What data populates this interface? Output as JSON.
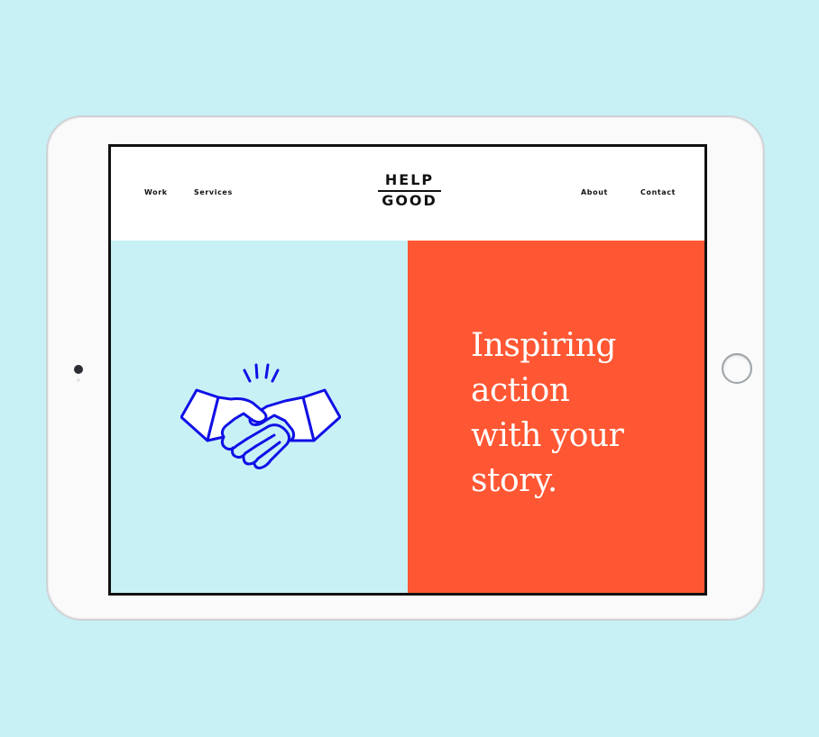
{
  "colors": {
    "backdrop": "#c8f1f6",
    "hero_left": "#c8f1f6",
    "hero_right": "#ff5733",
    "icon_stroke": "#1010e6",
    "text_dark": "#111111"
  },
  "nav": {
    "left": [
      "Work",
      "Services"
    ],
    "right": [
      "About",
      "Contact"
    ]
  },
  "logo": {
    "top": "HELP",
    "bottom": "GOOD"
  },
  "hero": {
    "illustration": "handshake-icon",
    "tagline_lines": [
      "Inspiring",
      "action",
      "with your",
      "story."
    ]
  },
  "device": {
    "camera": "camera-icon",
    "home_button": "home-button-icon"
  }
}
